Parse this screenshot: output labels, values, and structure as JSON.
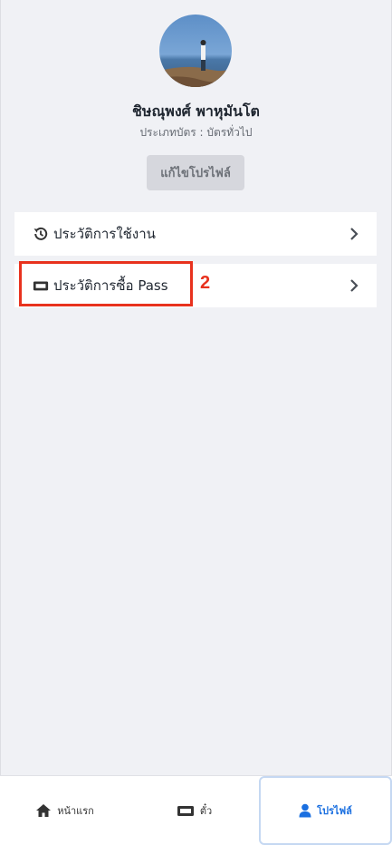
{
  "profile": {
    "name": "ชิษณุพงศ์ พาหุมันโต",
    "card_type": "ประเภทบัตร : บัตรทั่วไป",
    "edit_label": "แก้ไขโปรไฟล์"
  },
  "menu": {
    "items": [
      {
        "label": "ประวัติการใช้งาน",
        "icon": "history-icon"
      },
      {
        "label": "ประวัติการซื้อ Pass",
        "icon": "ticket-icon"
      }
    ]
  },
  "annotation": {
    "step_number": "2",
    "color": "#e8321e"
  },
  "bottom_nav": {
    "items": [
      {
        "label": "หน้าแรก",
        "icon": "home-icon",
        "active": false
      },
      {
        "label": "ตั๋ว",
        "icon": "ticket-icon",
        "active": false
      },
      {
        "label": "โปรไฟล์",
        "icon": "user-icon",
        "active": true
      }
    ]
  },
  "colors": {
    "accent": "#1a6fe0",
    "background": "#f0f1f5"
  }
}
